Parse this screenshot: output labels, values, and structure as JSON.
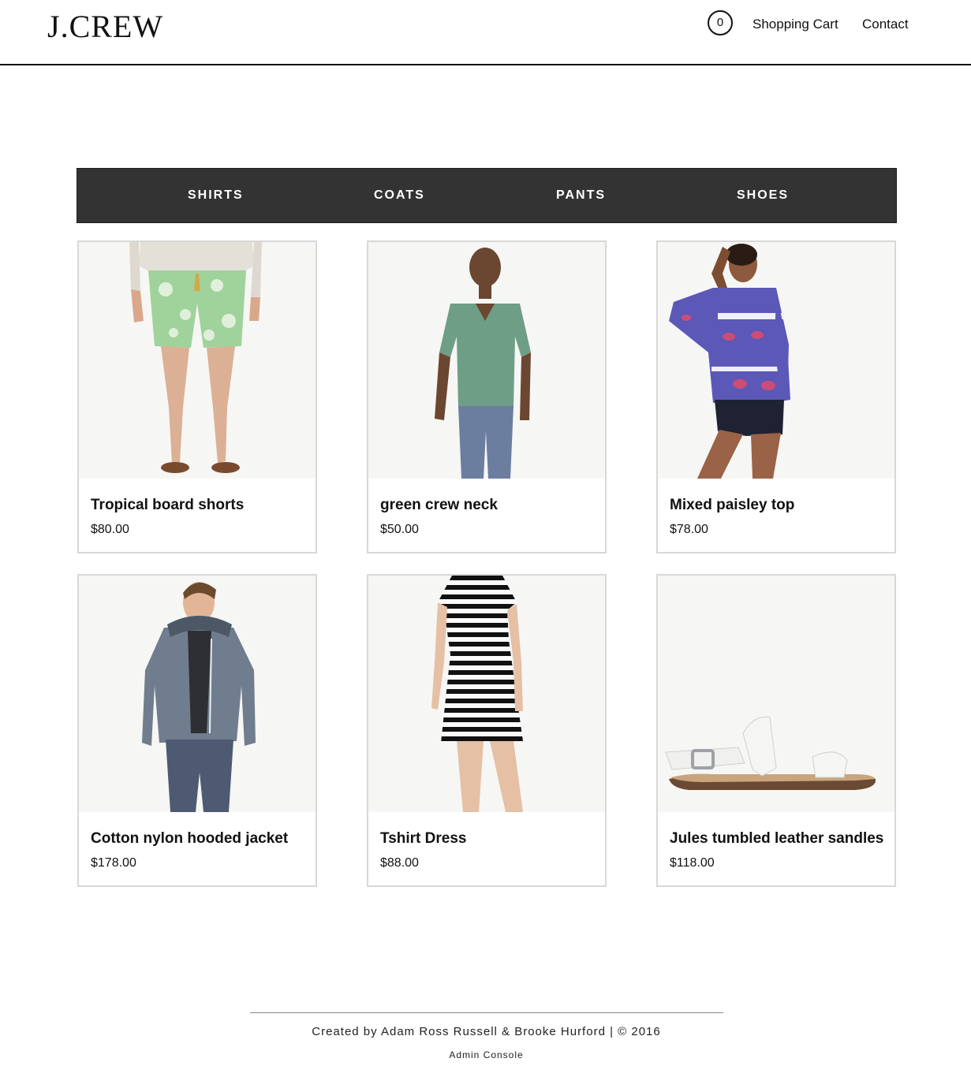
{
  "header": {
    "logo": "J.CREW",
    "cart_count": "0",
    "cart_label": "Shopping Cart",
    "contact_label": "Contact"
  },
  "categories": [
    "SHIRTS",
    "COATS",
    "PANTS",
    "SHOES"
  ],
  "products": [
    {
      "name": "Tropical board shorts",
      "price": "$80.00",
      "image": "model-board-shorts"
    },
    {
      "name": "green crew neck",
      "price": "$50.00",
      "image": "model-green-tee"
    },
    {
      "name": "Mixed paisley top",
      "price": "$78.00",
      "image": "model-paisley-top"
    },
    {
      "name": "Cotton nylon hooded jacket",
      "price": "$178.00",
      "image": "model-hooded-jacket"
    },
    {
      "name": "Tshirt Dress",
      "price": "$88.00",
      "image": "model-striped-dress"
    },
    {
      "name": "Jules tumbled leather sandles",
      "price": "$118.00",
      "image": "white-leather-sandal"
    }
  ],
  "footer": {
    "credit": "Created by Adam Ross Russell & Brooke Hurford | © 2016",
    "admin_link": "Admin Console"
  },
  "colors": {
    "category_bar": "#333333",
    "card_border": "#d8d8d8",
    "text": "#111111"
  }
}
